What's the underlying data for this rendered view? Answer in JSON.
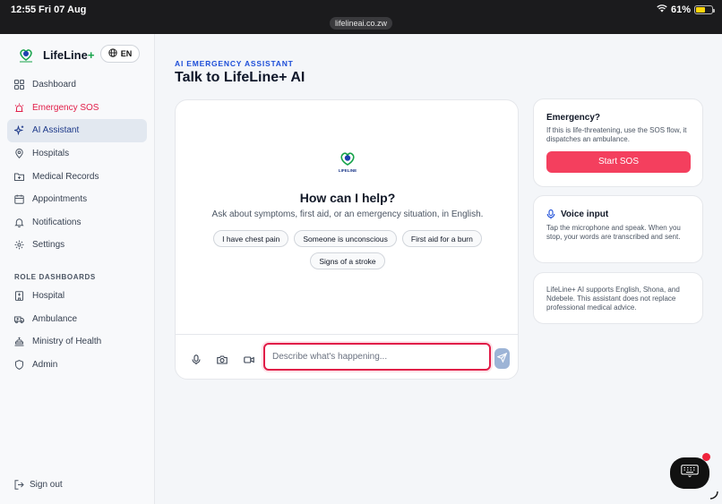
{
  "statusbar": {
    "time": "12:55",
    "date": "Fri 07 Aug",
    "url": "lifelineai.co.zw",
    "battery": "61%",
    "battery_level": 0.61
  },
  "brand": {
    "name": "LifeLine",
    "plus": "+",
    "lang": "EN",
    "logo_text": "LIFELINE"
  },
  "nav": {
    "items": [
      {
        "label": "Dashboard",
        "icon": "grid-icon"
      },
      {
        "label": "Emergency SOS",
        "icon": "siren-icon"
      },
      {
        "label": "AI Assistant",
        "icon": "sparkles-icon"
      },
      {
        "label": "Hospitals",
        "icon": "map-pin-icon"
      },
      {
        "label": "Medical Records",
        "icon": "folder-icon"
      },
      {
        "label": "Appointments",
        "icon": "calendar-icon"
      },
      {
        "label": "Notifications",
        "icon": "bell-icon"
      },
      {
        "label": "Settings",
        "icon": "gear-icon"
      }
    ],
    "section_label": "ROLE DASHBOARDS",
    "role_items": [
      {
        "label": "Hospital",
        "icon": "building-icon"
      },
      {
        "label": "Ambulance",
        "icon": "ambulance-icon"
      },
      {
        "label": "Ministry of Health",
        "icon": "landmark-icon"
      },
      {
        "label": "Admin",
        "icon": "shield-icon"
      }
    ],
    "signout": "Sign out"
  },
  "header": {
    "kicker": "AI EMERGENCY ASSISTANT",
    "title": "Talk to LifeLine+ AI"
  },
  "chat": {
    "heading": "How can I help?",
    "subheading": "Ask about symptoms, first aid, or an emergency situation, in English.",
    "suggestions": [
      "I have chest pain",
      "Someone is unconscious",
      "First aid for a burn",
      "Signs of a stroke"
    ],
    "input_placeholder": "Describe what's happening...",
    "input_value": ""
  },
  "cards": {
    "emergency": {
      "title": "Emergency?",
      "text": "If this is life-threatening, use the SOS flow, it dispatches an ambulance.",
      "button": "Start SOS"
    },
    "voice": {
      "title": "Voice input",
      "text": "Tap the microphone and speak. When you stop, your words are transcribed and sent."
    },
    "info": {
      "text": "LifeLine+ AI supports English, Shona, and Ndebele. This assistant does not replace professional medical advice."
    }
  },
  "colors": {
    "accent": "#1d4ed8",
    "sos": "#e11d48",
    "sos_button": "#f43f5e",
    "brand_green": "#16a34a"
  }
}
